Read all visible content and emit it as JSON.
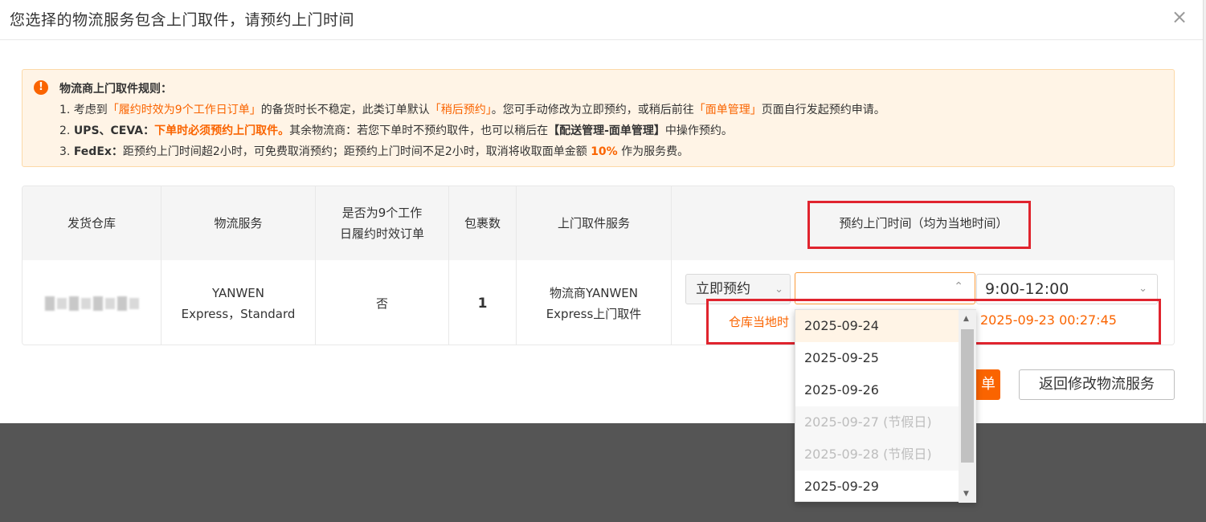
{
  "modal": {
    "title": "您选择的物流服务包含上门取件，请预约上门时间",
    "close_icon": "×"
  },
  "notice": {
    "icon": "!",
    "title": "物流商上门取件规则：",
    "line1": {
      "a": "1. 考虑到",
      "b": "「履约时效为9个工作日订单」",
      "c": "的备货时长不稳定，此类订单默认",
      "d": "「稍后预约」",
      "e": "。您可手动修改为立即预约，或稍后前往",
      "f": "「面单管理」",
      "g": "页面自行发起预约申请。"
    },
    "line2": {
      "a": "2. ",
      "b": "UPS、CEVA：",
      "c": "下单时必须预约上门取件。",
      "d": "其余物流商：若您下单时不预约取件，也可以稍后在",
      "e": "【配送管理-面单管理】",
      "f": "中操作预约。"
    },
    "line3": {
      "a": "3. ",
      "b": "FedEx：",
      "c": "距预约上门时间超2小时，可免费取消预约；距预约上门时间不足2小时，取消将收取面单金额 ",
      "d": "10%",
      "e": " 作为服务费。"
    }
  },
  "table": {
    "headers": {
      "warehouse": "发货仓库",
      "service": "物流服务",
      "nine_day_1": "是否为9个工作",
      "nine_day_2": "日履约时效订单",
      "packages": "包裹数",
      "pickup": "上门取件服务",
      "time": "预约上门时间（均为当地时间）"
    },
    "row": {
      "service_1": "YANWEN",
      "service_2": "Express，Standard",
      "nine_day": "否",
      "packages": "1",
      "pickup_1": "物流商YANWEN",
      "pickup_2": "Express上门取件"
    }
  },
  "schedule": {
    "mode": "立即预约",
    "date_value": "",
    "time_value": "9:00-12:00",
    "note_left": "仓库当地时",
    "note_right": "2025-09-23 00:27:45"
  },
  "dropdown": {
    "options": [
      {
        "label": "2025-09-24"
      },
      {
        "label": "2025-09-25"
      },
      {
        "label": "2025-09-26"
      },
      {
        "label": "2025-09-27 (节假日)"
      },
      {
        "label": "2025-09-28 (节假日)"
      },
      {
        "label": "2025-09-29"
      }
    ]
  },
  "buttons": {
    "submit": "单",
    "back": "返回修改物流服务"
  },
  "icons": {
    "chevron_down": "chevron-down-icon",
    "chevron_up": "chevron-up-icon",
    "warning": "warning-icon"
  },
  "colors": {
    "accent": "#fa6400",
    "highlight_box": "#e0242e",
    "notice_bg": "#fff4e6"
  }
}
